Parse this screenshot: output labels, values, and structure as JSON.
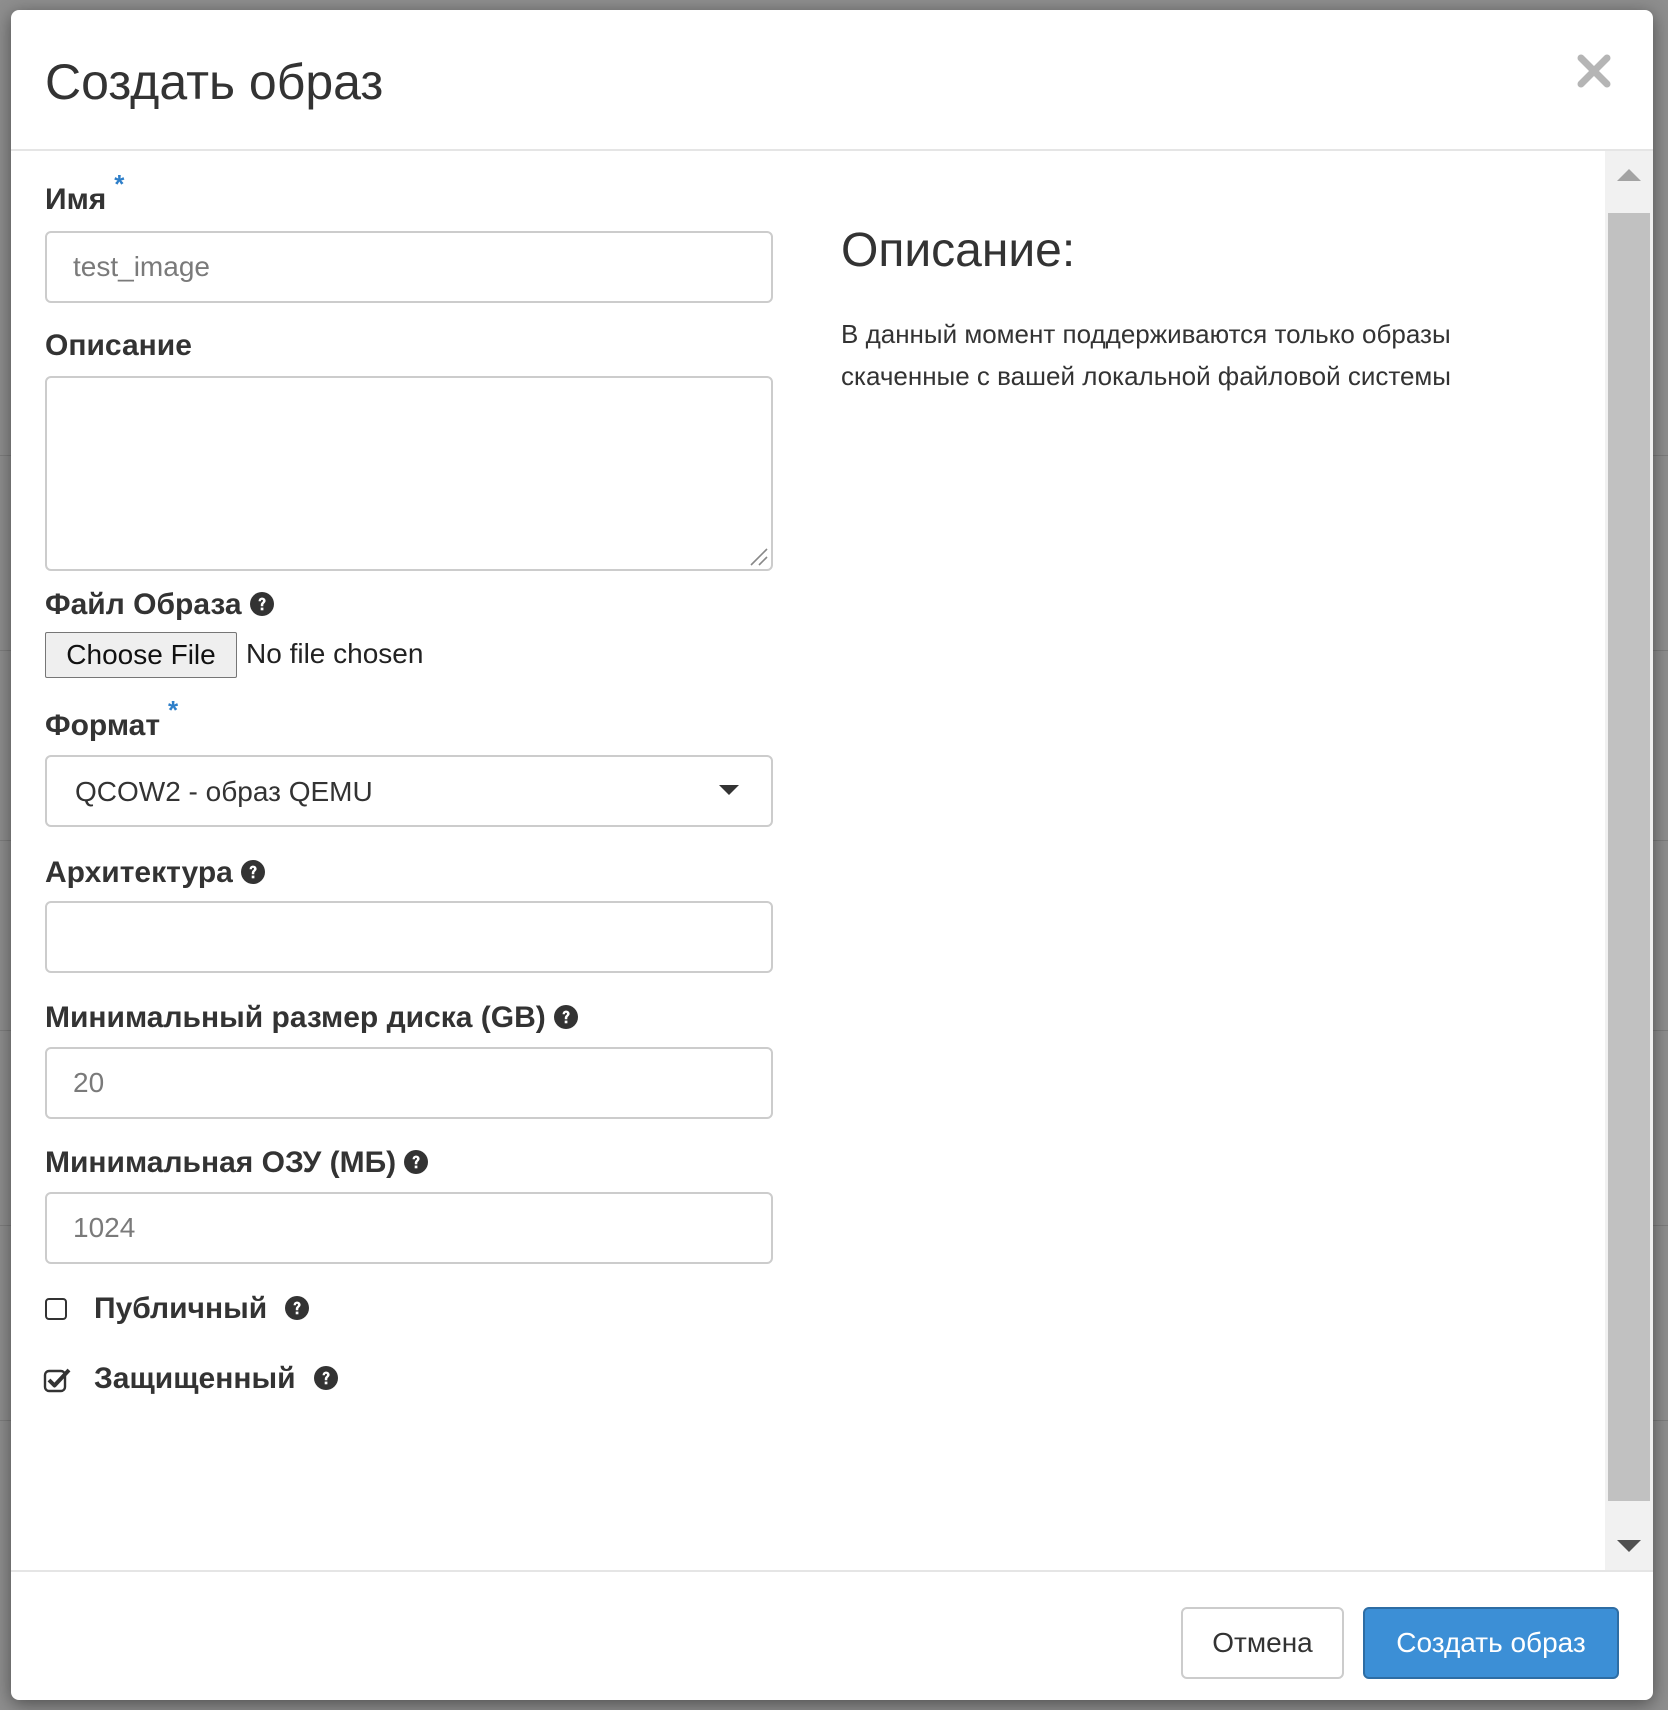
{
  "modal": {
    "title": "Создать образ"
  },
  "form": {
    "name": {
      "label": "Имя",
      "required_mark": "*",
      "placeholder": "test_image"
    },
    "description": {
      "label": "Описание",
      "value": ""
    },
    "image_file": {
      "label": "Файл Образа",
      "button_label": "Choose File",
      "status": "No file chosen"
    },
    "format": {
      "label": "Формат",
      "required_mark": "*",
      "selected": "QCOW2 - образ QEMU"
    },
    "architecture": {
      "label": "Архитектура",
      "value": ""
    },
    "min_disk": {
      "label": "Минимальный размер диска (GB)",
      "placeholder": "20"
    },
    "min_ram": {
      "label": "Минимальная ОЗУ (МБ)",
      "placeholder": "1024"
    },
    "public": {
      "label": "Публичный",
      "checked": false
    },
    "protected": {
      "label": "Защищенный",
      "checked": true
    }
  },
  "help_panel": {
    "heading": "Описание:",
    "text": "В данный момент поддерживаются только образы скаченные с вашей локальной файловой системы"
  },
  "footer": {
    "cancel_label": "Отмена",
    "submit_label": "Создать образ"
  },
  "colors": {
    "primary": "#3c8fd6",
    "required": "#2e7fc9",
    "text": "#333333"
  },
  "icons": {
    "close": "close-icon",
    "help": "question-circle-icon",
    "caret": "caret-down-icon",
    "check": "check-square-icon"
  }
}
